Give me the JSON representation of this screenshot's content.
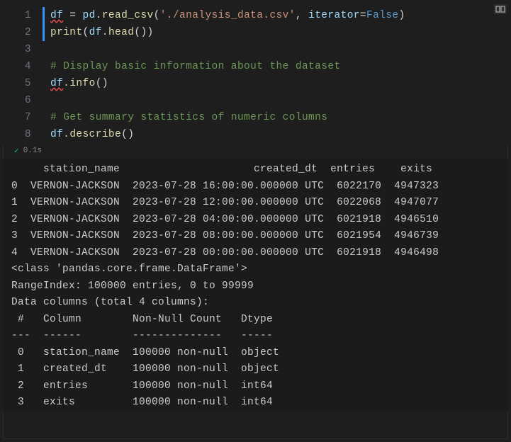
{
  "code": {
    "lines": [
      {
        "n": "1",
        "bar": true,
        "segs": [
          [
            "var",
            "df"
          ],
          [
            "op",
            " = "
          ],
          [
            "var",
            "pd"
          ],
          [
            "punct",
            "."
          ],
          [
            "fn",
            "read_csv"
          ],
          [
            "punct",
            "("
          ],
          [
            "str",
            "'./analysis_data.csv'"
          ],
          [
            "punct",
            ", "
          ],
          [
            "arg",
            "iterator"
          ],
          [
            "op",
            "="
          ],
          [
            "bool",
            "False"
          ],
          [
            "punct",
            ")"
          ]
        ],
        "squiggle": "df"
      },
      {
        "n": "2",
        "bar": true,
        "segs": [
          [
            "fn",
            "print"
          ],
          [
            "punct",
            "("
          ],
          [
            "var",
            "df"
          ],
          [
            "punct",
            "."
          ],
          [
            "fn",
            "head"
          ],
          [
            "punct",
            "())"
          ]
        ]
      },
      {
        "n": "3",
        "bar": false,
        "segs": []
      },
      {
        "n": "4",
        "bar": false,
        "segs": [
          [
            "comment",
            "# Display basic information about the dataset"
          ]
        ]
      },
      {
        "n": "5",
        "bar": false,
        "segs": [
          [
            "var",
            "df"
          ],
          [
            "punct",
            "."
          ],
          [
            "fn",
            "info"
          ],
          [
            "punct",
            "()"
          ]
        ],
        "squiggle": "df"
      },
      {
        "n": "6",
        "bar": false,
        "segs": []
      },
      {
        "n": "7",
        "bar": false,
        "segs": [
          [
            "comment",
            "# Get summary statistics of numeric columns"
          ]
        ]
      },
      {
        "n": "8",
        "bar": false,
        "segs": [
          [
            "var",
            "df"
          ],
          [
            "punct",
            "."
          ],
          [
            "fn",
            "describe"
          ],
          [
            "punct",
            "()"
          ]
        ]
      }
    ]
  },
  "exec": {
    "status_icon": "✓",
    "time": "0.1s"
  },
  "output": {
    "head_header": "     station_name                     created_dt  entries    exits",
    "head_rows": [
      "0  VERNON-JACKSON  2023-07-28 16:00:00.000000 UTC  6022170  4947323",
      "1  VERNON-JACKSON  2023-07-28 12:00:00.000000 UTC  6022068  4947077",
      "2  VERNON-JACKSON  2023-07-28 04:00:00.000000 UTC  6021918  4946510",
      "3  VERNON-JACKSON  2023-07-28 08:00:00.000000 UTC  6021954  4946739",
      "4  VERNON-JACKSON  2023-07-28 00:00:00.000000 UTC  6021918  4946498"
    ],
    "info_lines": [
      "<class 'pandas.core.frame.DataFrame'>",
      "RangeIndex: 100000 entries, 0 to 99999",
      "Data columns (total 4 columns):",
      " #   Column        Non-Null Count   Dtype ",
      "---  ------        --------------   ----- ",
      " 0   station_name  100000 non-null  object",
      " 1   created_dt    100000 non-null  object",
      " 2   entries       100000 non-null  int64 ",
      " 3   exits         100000 non-null  int64 "
    ]
  }
}
